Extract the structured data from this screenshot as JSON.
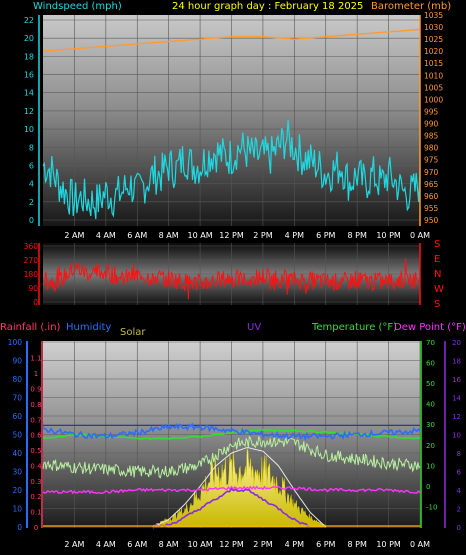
{
  "header": {
    "windspeed_label": "Windspeed (mph)",
    "title": "24 hour graph day : February 18 2025",
    "barometer_label": "Barometer (mb)"
  },
  "colors": {
    "windspeed": "#20d8e0",
    "barometer": "#ff9a30",
    "wind_direction": "#ff1010",
    "rainfall": "#ff3b6b",
    "humidity": "#2b6cff",
    "solar": "#e6d000",
    "uv": "#8a2be2",
    "temperature": "#33dd33",
    "dew_point": "#ff33ff"
  },
  "chart_data": [
    {
      "type": "line",
      "name": "wind-barometer-panel",
      "x_ticks": [
        "2 AM",
        "4 AM",
        "6 AM",
        "8 AM",
        "10 AM",
        "12 PM",
        "2 PM",
        "4 PM",
        "6 PM",
        "8 PM",
        "10 PM",
        "0 AM"
      ],
      "x_range": [
        0,
        24
      ],
      "y_left": {
        "label": "Windspeed (mph)",
        "ticks": [
          "0",
          "2",
          "4",
          "6",
          "8",
          "10",
          "12",
          "14",
          "16",
          "18",
          "20",
          "22"
        ],
        "range": [
          0,
          22
        ]
      },
      "y_right": {
        "label": "Barometer (mb)",
        "ticks": [
          "950",
          "955",
          "960",
          "965",
          "970",
          "975",
          "980",
          "985",
          "990",
          "995",
          "1000",
          "1005",
          "1010",
          "1015",
          "1020",
          "1025",
          "1030",
          "1035"
        ],
        "range": [
          950,
          1035
        ]
      },
      "series": [
        {
          "name": "Windspeed (mph)",
          "axis": "left",
          "x": [
            0,
            0.5,
            1,
            1.5,
            2,
            2.5,
            3,
            3.5,
            4,
            4.5,
            5,
            5.5,
            6,
            6.5,
            7,
            7.5,
            8,
            8.5,
            9,
            9.5,
            10,
            10.5,
            11,
            11.5,
            12,
            12.5,
            13,
            13.5,
            14,
            14.5,
            15,
            15.5,
            16,
            16.5,
            17,
            17.5,
            18,
            18.5,
            19,
            19.5,
            20,
            20.5,
            21,
            21.5,
            22,
            22.5,
            23,
            23.5,
            24
          ],
          "values": [
            6,
            5.5,
            4,
            3,
            2,
            2.5,
            2,
            2,
            3,
            2.5,
            3,
            4,
            3,
            4,
            5,
            5,
            6,
            5.5,
            7,
            6,
            6,
            7,
            7.5,
            7,
            7,
            8,
            7.5,
            7,
            7,
            7,
            8,
            9,
            8,
            7,
            6.5,
            6,
            5,
            5.5,
            6,
            4,
            5,
            4,
            5,
            4,
            5,
            4,
            3,
            3,
            4
          ]
        },
        {
          "name": "Barometer (mb)",
          "axis": "right",
          "x": [
            0,
            2,
            4,
            6,
            8,
            10,
            12,
            14,
            16,
            18,
            20,
            22,
            24
          ],
          "values": [
            1020,
            1021,
            1022,
            1023,
            1024,
            1025,
            1026,
            1026,
            1025,
            1026,
            1027,
            1028,
            1029
          ]
        }
      ]
    },
    {
      "type": "line",
      "name": "wind-direction-panel",
      "x_range": [
        0,
        24
      ],
      "y_left": {
        "ticks": [
          "0",
          "90",
          "180",
          "270",
          "360"
        ],
        "range": [
          0,
          360
        ]
      },
      "y_right": {
        "ticks": [
          "S",
          "E",
          "N",
          "W",
          "S"
        ]
      },
      "series": [
        {
          "name": "Wind direction",
          "x": [
            0,
            1,
            2,
            3,
            4,
            5,
            6,
            7,
            8,
            9,
            10,
            11,
            12,
            13,
            14,
            15,
            16,
            17,
            18,
            19,
            20,
            21,
            22,
            23,
            24
          ],
          "values": [
            140,
            130,
            220,
            180,
            200,
            150,
            170,
            160,
            150,
            130,
            120,
            140,
            150,
            140,
            160,
            150,
            140,
            140,
            130,
            130,
            140,
            130,
            130,
            150,
            140
          ]
        }
      ]
    },
    {
      "type": "area",
      "name": "weather-panel",
      "x_ticks": [
        "2 AM",
        "4 AM",
        "6 AM",
        "8 AM",
        "10 AM",
        "12 PM",
        "2 PM",
        "4 PM",
        "6 PM",
        "8 PM",
        "10 PM",
        "0 AM"
      ],
      "x_range": [
        0,
        24
      ],
      "legend": [
        "Rainfall (.in)",
        "Humidity",
        "Solar",
        "UV",
        "Temperature (°F)",
        "Dew Point (°F)"
      ],
      "y_humidity": {
        "ticks": [
          "0",
          "10",
          "20",
          "30",
          "40",
          "50",
          "60",
          "70",
          "80",
          "90",
          "100"
        ],
        "range": [
          0,
          100
        ]
      },
      "y_rain": {
        "ticks": [
          "0",
          "0.1",
          "0.2",
          "0.3",
          "0.4",
          "0.5",
          "0.6",
          "0.7",
          "0.8",
          "0.9",
          "1",
          "1.1"
        ],
        "range": [
          0,
          1.15
        ]
      },
      "y_temp": {
        "ticks": [
          "-10",
          "0",
          "10",
          "20",
          "30",
          "40",
          "50",
          "60",
          "70"
        ],
        "range": [
          -20,
          70
        ]
      },
      "y_uv": {
        "ticks": [
          "0",
          "2",
          "4",
          "6",
          "8",
          "10",
          "12",
          "14",
          "16",
          "18",
          "20"
        ],
        "range": [
          0,
          20
        ]
      },
      "series": [
        {
          "name": "Humidity",
          "axis": "humidity",
          "x": [
            0,
            2,
            4,
            6,
            8,
            10,
            12,
            14,
            16,
            18,
            20,
            22,
            24
          ],
          "values": [
            53,
            50,
            49,
            51,
            54,
            54,
            52,
            50,
            49,
            49,
            50,
            51,
            52
          ]
        },
        {
          "name": "Temperature (°F)",
          "axis": "temp",
          "x": [
            0,
            2,
            4,
            6,
            8,
            10,
            12,
            14,
            16,
            18,
            20,
            22,
            24
          ],
          "values": [
            11,
            9,
            8,
            7,
            7,
            10,
            20,
            22,
            21,
            15,
            13,
            11,
            10
          ]
        },
        {
          "name": "Dew Point (°F)",
          "axis": "temp",
          "x": [
            0,
            2,
            4,
            6,
            8,
            10,
            12,
            14,
            16,
            18,
            20,
            22,
            24
          ],
          "values": [
            -3,
            -3,
            -3,
            -2,
            -2,
            -2,
            -1,
            -1,
            -1,
            -2,
            -2,
            -2,
            -3
          ]
        },
        {
          "name": "Temperature reference",
          "axis": "temp",
          "x": [
            0,
            2,
            4,
            6,
            8,
            10,
            12,
            14,
            16,
            18,
            20,
            22,
            24
          ],
          "values": [
            23,
            25,
            24,
            23,
            23,
            24,
            26,
            27,
            27,
            26,
            25,
            24,
            23
          ]
        },
        {
          "name": "Humidity threshold",
          "axis": "humidity",
          "x": [
            0,
            24
          ],
          "values": [
            55,
            55
          ]
        },
        {
          "name": "Solar",
          "axis": "humidity",
          "x": [
            7,
            8,
            9,
            10,
            11,
            12,
            13,
            14,
            15,
            16,
            17,
            18
          ],
          "values": [
            1,
            5,
            10,
            22,
            35,
            36,
            37,
            35,
            28,
            14,
            6,
            1
          ]
        },
        {
          "name": "Solar max",
          "axis": "humidity",
          "x": [
            7,
            8,
            9,
            10,
            11,
            12,
            13,
            14,
            15,
            16,
            17,
            18
          ],
          "values": [
            0,
            4,
            12,
            22,
            33,
            40,
            43,
            41,
            33,
            20,
            8,
            0
          ]
        },
        {
          "name": "UV",
          "axis": "uv",
          "x": [
            7,
            8,
            9,
            10,
            11,
            12,
            13,
            14,
            15,
            16,
            17
          ],
          "values": [
            0,
            0.2,
            1,
            2,
            3,
            4,
            4,
            3,
            2,
            0.8,
            0
          ]
        }
      ]
    }
  ],
  "legend_labels": {
    "rainfall": "Rainfall (.in)",
    "humidity": "Humidity",
    "solar": "Solar",
    "uv": "UV",
    "temperature": "Temperature (°F)",
    "dew_point": "Dew Point (°F)"
  }
}
